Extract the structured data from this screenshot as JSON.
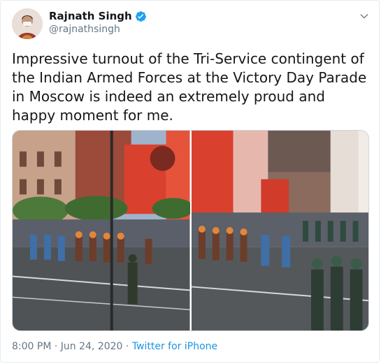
{
  "author": {
    "name": "Rajnath Singh",
    "handle": "@rajnathsingh",
    "verified": true
  },
  "tweet": {
    "text": "Impressive turnout of the Tri-Service contingent of the Indian Armed Forces at the Victory Day Parade in Moscow is indeed an extremely proud and happy moment for me."
  },
  "media": {
    "photos": [
      {
        "subject": "parade-red-square-left"
      },
      {
        "subject": "parade-red-square-right"
      }
    ]
  },
  "meta": {
    "time": "8:00 PM",
    "separator1": " · ",
    "date": "Jun 24, 2020",
    "separator2": " · ",
    "source": "Twitter for iPhone"
  },
  "colors": {
    "link": "#1b95e0",
    "verified": "#1da1f2",
    "secondary_text": "#657786"
  },
  "icons": {
    "verified": "verified-badge-icon",
    "caret": "chevron-down-icon"
  }
}
